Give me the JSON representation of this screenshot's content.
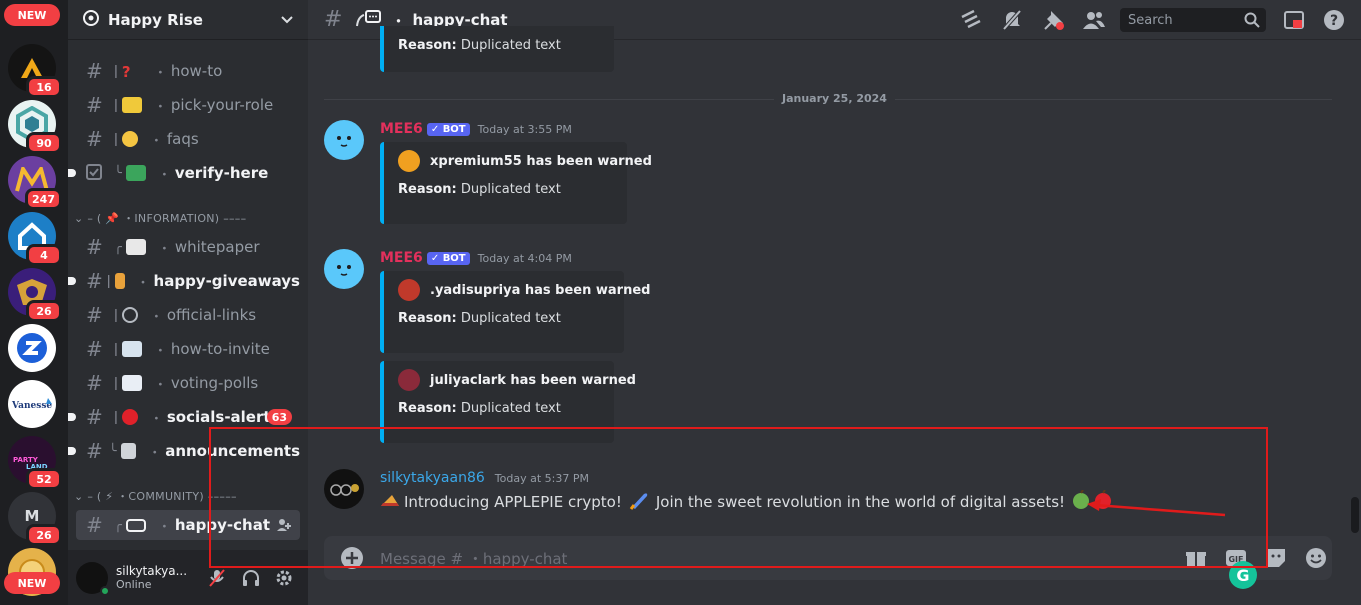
{
  "rail": {
    "top_pill": "NEW",
    "bottom_pill": "NEW",
    "servers": [
      {
        "id": "s1",
        "badge": "16",
        "color": "#141414",
        "letter": ""
      },
      {
        "id": "s2",
        "badge": "90",
        "color": "#5aa9a8",
        "letter": ""
      },
      {
        "id": "s3",
        "badge": "247",
        "color": "#5b3a8a",
        "letter": ""
      },
      {
        "id": "s4",
        "badge": "4",
        "color": "#1d7fc7",
        "letter": ""
      },
      {
        "id": "s5",
        "badge": "26",
        "color": "#3a1e7a",
        "letter": ""
      },
      {
        "id": "s6",
        "badge": "",
        "color": "#ffffff",
        "letter": ""
      },
      {
        "id": "s7",
        "badge": "",
        "color": "#ffffff",
        "letter": ""
      },
      {
        "id": "s8",
        "badge": "52",
        "color": "#2a0f2f",
        "letter": ""
      },
      {
        "id": "s9",
        "badge": "26",
        "color": "#313338",
        "letter": "M"
      },
      {
        "id": "s10",
        "badge": "",
        "color": "#e5b24a",
        "letter": ""
      }
    ]
  },
  "guild": {
    "name": "Happy Rise"
  },
  "channels": {
    "how_to": "how-to",
    "pick_your_role": "pick-your-role",
    "faqs": "faqs",
    "verify_here": "verify-here",
    "cat_information": "⌄ – ( 📌 ・INFORMATION) ––––",
    "whitepaper": "whitepaper",
    "happy_giveaways": "happy-giveaways",
    "official_links": "official-links",
    "how_to_invite": "how-to-invite",
    "voting_polls": "voting-polls",
    "socials_alert": "socials-alert",
    "socials_alert_badge": "63",
    "announcements": "announcements",
    "cat_community": "⌄ – ( ⚡ ・COMMUNITY) –––––",
    "happy_chat": "happy-chat"
  },
  "user": {
    "name": "silkytakya...",
    "status": "Online"
  },
  "topbar": {
    "channel": "happy-chat",
    "search_placeholder": "Search"
  },
  "messages": {
    "top_reason_label": "Reason:",
    "top_reason_text": "Duplicated text",
    "date_divider": "January 25, 2024",
    "m1": {
      "author": "MEE6",
      "bot": "BOT",
      "time": "Today at 3:55 PM",
      "embed_title": "xpremium55 has been warned",
      "reason_label": "Reason:",
      "reason_text": "Duplicated text"
    },
    "m2": {
      "author": "MEE6",
      "bot": "BOT",
      "time": "Today at 4:04 PM",
      "embed1_title": ".yadisupriya has been warned",
      "embed1_reason_label": "Reason:",
      "embed1_reason_text": "Duplicated text",
      "embed2_title": "juliyaclark has been warned",
      "embed2_reason_label": "Reason:",
      "embed2_reason_text": "Duplicated text"
    },
    "m3": {
      "author": "silkytakyaan86",
      "time": "Today at 5:37 PM",
      "text_a": "Introducing APPLEPIE crypto!",
      "text_b": "Join the sweet revolution in the world of digital assets!"
    }
  },
  "composer": {
    "placeholder": "Message #    ・happy-chat"
  },
  "colors": {
    "mee6": "#e3305c",
    "silky": "#3ba7e8",
    "embed_border": "#00aff4",
    "highlight": "#e01b1b"
  }
}
